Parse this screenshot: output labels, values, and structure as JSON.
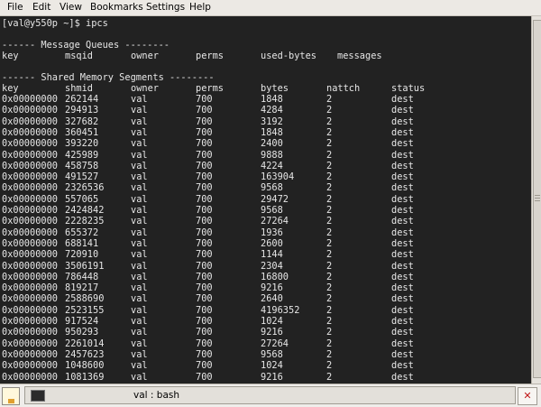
{
  "menu": [
    "File",
    "Edit",
    "View",
    "Bookmarks",
    "Settings",
    "Help"
  ],
  "terminal": {
    "prompt": "[val@y550p ~]$ ipcs",
    "mq_header": "------ Message Queues --------",
    "mq_columns": [
      "key",
      "msqid",
      "owner",
      "perms",
      "used-bytes",
      "messages"
    ],
    "shm_header": "------ Shared Memory Segments --------",
    "shm_columns": [
      "key",
      "shmid",
      "owner",
      "perms",
      "bytes",
      "nattch",
      "status"
    ],
    "shm_rows": [
      [
        "0x00000000",
        "262144",
        "val",
        "700",
        "1848",
        "2",
        "dest"
      ],
      [
        "0x00000000",
        "294913",
        "val",
        "700",
        "4284",
        "2",
        "dest"
      ],
      [
        "0x00000000",
        "327682",
        "val",
        "700",
        "3192",
        "2",
        "dest"
      ],
      [
        "0x00000000",
        "360451",
        "val",
        "700",
        "1848",
        "2",
        "dest"
      ],
      [
        "0x00000000",
        "393220",
        "val",
        "700",
        "2400",
        "2",
        "dest"
      ],
      [
        "0x00000000",
        "425989",
        "val",
        "700",
        "9888",
        "2",
        "dest"
      ],
      [
        "0x00000000",
        "458758",
        "val",
        "700",
        "4224",
        "2",
        "dest"
      ],
      [
        "0x00000000",
        "491527",
        "val",
        "700",
        "163904",
        "2",
        "dest"
      ],
      [
        "0x00000000",
        "2326536",
        "val",
        "700",
        "9568",
        "2",
        "dest"
      ],
      [
        "0x00000000",
        "557065",
        "val",
        "700",
        "29472",
        "2",
        "dest"
      ],
      [
        "0x00000000",
        "2424842",
        "val",
        "700",
        "9568",
        "2",
        "dest"
      ],
      [
        "0x00000000",
        "2228235",
        "val",
        "700",
        "27264",
        "2",
        "dest"
      ],
      [
        "0x00000000",
        "655372",
        "val",
        "700",
        "1936",
        "2",
        "dest"
      ],
      [
        "0x00000000",
        "688141",
        "val",
        "700",
        "2600",
        "2",
        "dest"
      ],
      [
        "0x00000000",
        "720910",
        "val",
        "700",
        "1144",
        "2",
        "dest"
      ],
      [
        "0x00000000",
        "3506191",
        "val",
        "700",
        "2304",
        "2",
        "dest"
      ],
      [
        "0x00000000",
        "786448",
        "val",
        "700",
        "16800",
        "2",
        "dest"
      ],
      [
        "0x00000000",
        "819217",
        "val",
        "700",
        "9216",
        "2",
        "dest"
      ],
      [
        "0x00000000",
        "2588690",
        "val",
        "700",
        "2640",
        "2",
        "dest"
      ],
      [
        "0x00000000",
        "2523155",
        "val",
        "700",
        "4196352",
        "2",
        "dest"
      ],
      [
        "0x00000000",
        "917524",
        "val",
        "700",
        "1024",
        "2",
        "dest"
      ],
      [
        "0x00000000",
        "950293",
        "val",
        "700",
        "9216",
        "2",
        "dest"
      ],
      [
        "0x00000000",
        "2261014",
        "val",
        "700",
        "27264",
        "2",
        "dest"
      ],
      [
        "0x00000000",
        "2457623",
        "val",
        "700",
        "9568",
        "2",
        "dest"
      ],
      [
        "0x00000000",
        "1048600",
        "val",
        "700",
        "1024",
        "2",
        "dest"
      ],
      [
        "0x00000000",
        "1081369",
        "val",
        "700",
        "9216",
        "2",
        "dest"
      ]
    ]
  },
  "taskbar": {
    "task_label": "val : bash",
    "close_glyph": "✕"
  },
  "colors": {
    "terminal_bg": "#222222",
    "terminal_fg": "#e6e6e6"
  }
}
